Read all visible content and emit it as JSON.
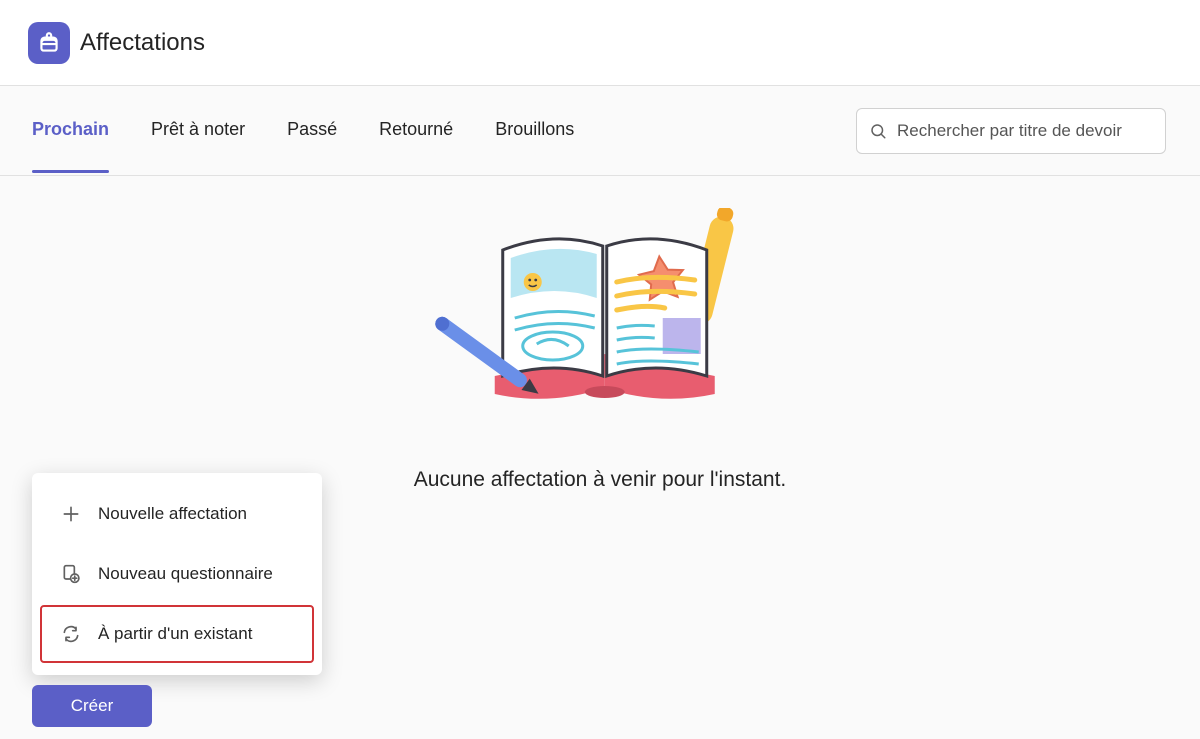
{
  "header": {
    "title": "Affectations"
  },
  "tabs": {
    "items": [
      "Prochain",
      "Prêt à noter",
      "Passé",
      "Retourné",
      "Brouillons"
    ],
    "active_index": 0
  },
  "search": {
    "placeholder": "Rechercher par titre de devoir"
  },
  "empty_state": {
    "message": "Aucune affectation à venir pour l'instant."
  },
  "create_menu": {
    "items": [
      {
        "label": "Nouvelle affectation",
        "icon": "plus-icon"
      },
      {
        "label": "Nouveau questionnaire",
        "icon": "quiz-icon"
      },
      {
        "label": "À partir d'un existant",
        "icon": "sync-icon"
      }
    ],
    "highlighted_index": 2
  },
  "create_button": {
    "label": "Créer"
  },
  "colors": {
    "accent": "#5b5fc7",
    "danger": "#d13438"
  }
}
